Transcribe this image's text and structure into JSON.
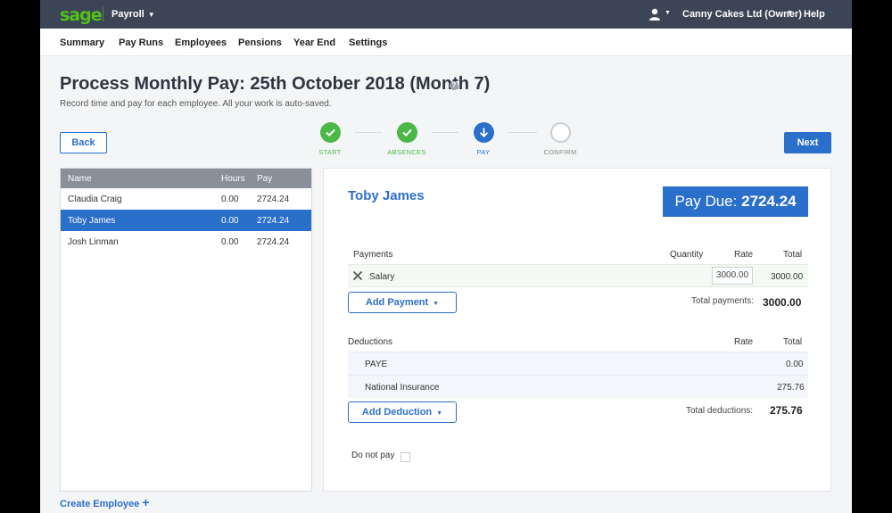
{
  "topbar": {
    "logo": "sage",
    "product": "Payroll",
    "company": "Canny Cakes Ltd (Owner)",
    "help": "Help"
  },
  "nav": [
    "Summary",
    "Pay Runs",
    "Employees",
    "Pensions",
    "Year End",
    "Settings"
  ],
  "page": {
    "title": "Process Monthly Pay: 25th October 2018 (Month 7)",
    "subtitle": "Record time and pay for each employee. All your work is auto-saved.",
    "back": "Back",
    "next": "Next"
  },
  "steps": [
    {
      "label": "START",
      "state": "done"
    },
    {
      "label": "ABSENCES",
      "state": "done"
    },
    {
      "label": "PAY",
      "state": "active"
    },
    {
      "label": "CONFIRM",
      "state": "pending"
    }
  ],
  "employees": {
    "headers": {
      "name": "Name",
      "hours": "Hours",
      "pay": "Pay"
    },
    "rows": [
      {
        "name": "Claudia Craig",
        "hours": "0.00",
        "pay": "2724.24"
      },
      {
        "name": "Toby James",
        "hours": "0.00",
        "pay": "2724.24"
      },
      {
        "name": "Josh Linman",
        "hours": "0.00",
        "pay": "2724.24"
      }
    ],
    "create": "Create Employee"
  },
  "detail": {
    "name": "Toby James",
    "pay_due_label": "Pay Due:",
    "pay_due_value": "2724.24",
    "payments": {
      "heading": "Payments",
      "quantity": "Quantity",
      "rate": "Rate",
      "total": "Total",
      "row": {
        "name": "Salary",
        "rate": "3000.00",
        "total": "3000.00"
      },
      "add": "Add Payment",
      "total_label": "Total payments:",
      "total_value": "3000.00"
    },
    "deductions": {
      "heading": "Deductions",
      "rate": "Rate",
      "total": "Total",
      "rows": [
        {
          "name": "PAYE",
          "total": "0.00"
        },
        {
          "name": "National Insurance",
          "total": "275.76"
        }
      ],
      "add": "Add Deduction",
      "total_label": "Total deductions:",
      "total_value": "275.76"
    },
    "do_not_pay": "Do not pay"
  },
  "colors": {
    "accent": "#2a6fc9",
    "brand_green": "#53c11a",
    "step_done": "#4cb848",
    "topbar": "#3c4555"
  }
}
